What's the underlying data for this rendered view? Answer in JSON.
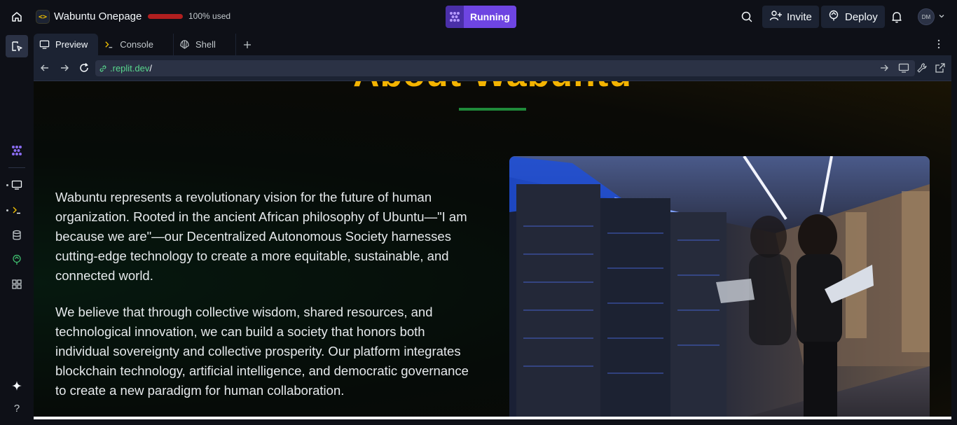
{
  "topbar": {
    "project_title": "Wabuntu Onepage",
    "usage_text": "100% used",
    "run_status": "Running",
    "invite_label": "Invite",
    "deploy_label": "Deploy",
    "avatar_initials": "DM"
  },
  "tabs": [
    {
      "label": "Preview",
      "icon": "monitor-icon",
      "active": true
    },
    {
      "label": "Console",
      "icon": "terminal-icon",
      "active": false
    },
    {
      "label": "Shell",
      "icon": "shell-icon",
      "active": false
    }
  ],
  "urlbar": {
    "host": ".replit.dev",
    "path": "/"
  },
  "page": {
    "title": "About Wabuntu",
    "paragraph1": "Wabuntu represents a revolutionary vision for the future of human organization. Rooted in the ancient African philosophy of Ubuntu—\"I am because we are\"—our Decentralized Autonomous Society harnesses cutting-edge technology to create a more equitable, sustainable, and connected world.",
    "paragraph2": "We believe that through collective wisdom, shared resources, and technological innovation, we can build a society that honors both individual sovereignty and collective prosperity. Our platform integrates blockchain technology, artificial intelligence, and democratic governance to create a new paradigm for human collaboration."
  },
  "colors": {
    "accent_gold": "#f4b400",
    "accent_green": "#1f8a3a",
    "run_purple": "#6e45e2",
    "usage_red": "#b01f1f"
  }
}
